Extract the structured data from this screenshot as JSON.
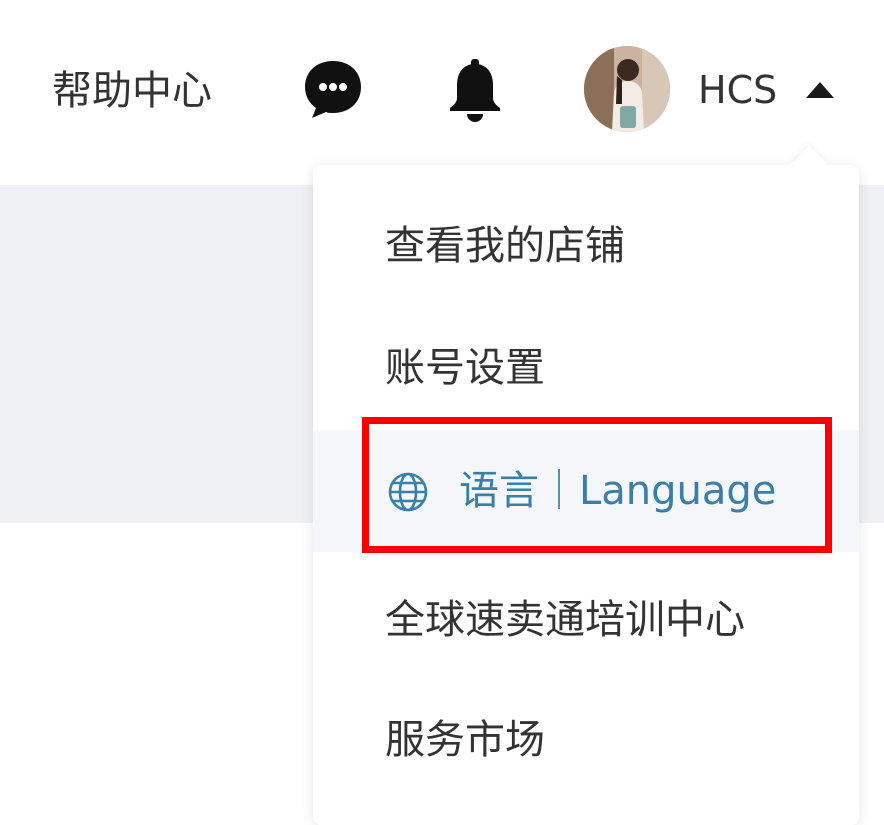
{
  "header": {
    "help_label": "帮助中心",
    "user_name": "HCS",
    "icons": {
      "chat": "chat-bubble-icon",
      "notifications": "bell-icon",
      "caret": "caret-up-icon"
    }
  },
  "dropdown": {
    "items": [
      {
        "label": "查看我的店铺"
      },
      {
        "label": "账号设置"
      },
      {
        "label": "语言｜Language",
        "icon": "globe-icon",
        "active": true
      },
      {
        "label": "全球速卖通培训中心"
      },
      {
        "label": "服务市场"
      }
    ]
  },
  "colors": {
    "accent": "#3a7fa8",
    "highlight": "#ff0000",
    "page_gray": "#eef0f4"
  }
}
